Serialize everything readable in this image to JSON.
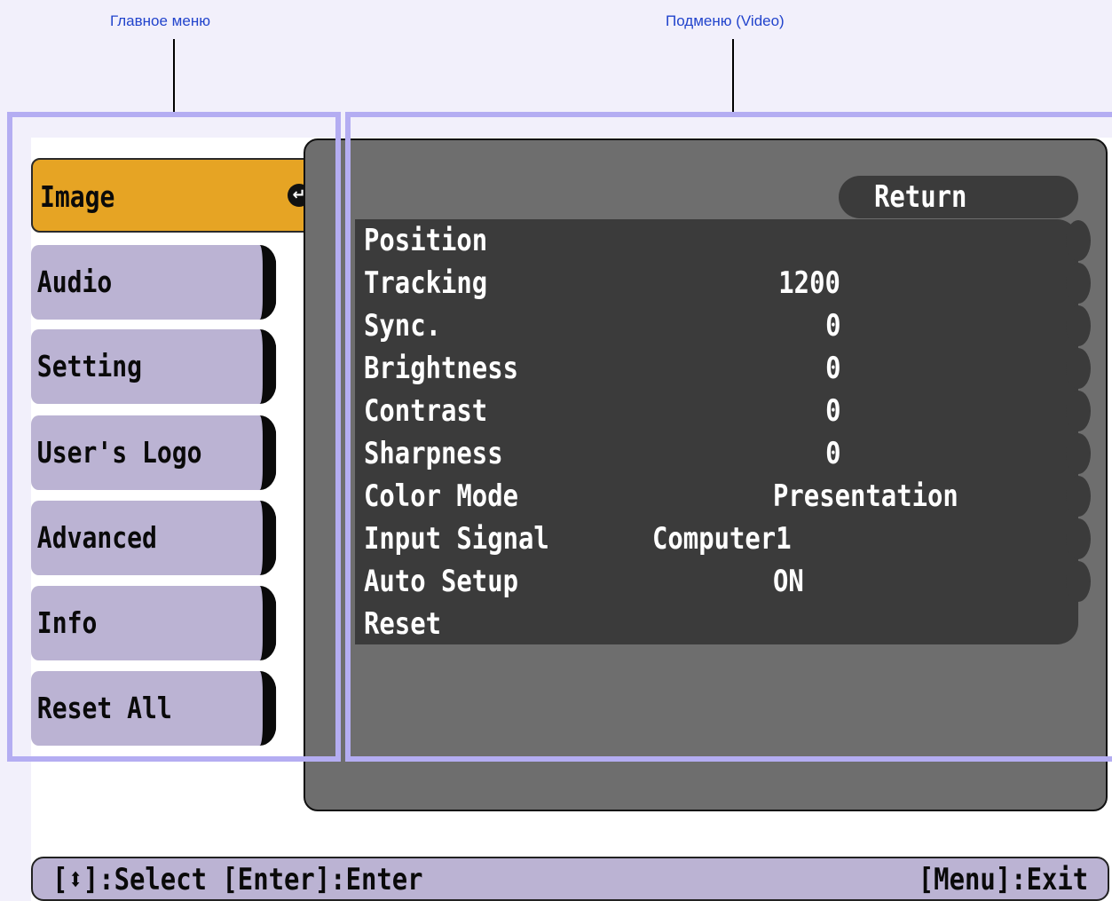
{
  "callouts": {
    "main_menu": "Главное меню",
    "submenu": "Подменю (Video)"
  },
  "main_menu": {
    "items": [
      {
        "label": "Image",
        "active": true
      },
      {
        "label": "Audio"
      },
      {
        "label": "Setting"
      },
      {
        "label": "User's Logo"
      },
      {
        "label": "Advanced"
      },
      {
        "label": "Info"
      },
      {
        "label": "Reset All"
      }
    ],
    "enter_icon": "enter-arrow-icon"
  },
  "submenu": {
    "return_label": "Return",
    "rows": [
      {
        "label": "Position",
        "value": ""
      },
      {
        "label": "Tracking",
        "value": "1200"
      },
      {
        "label": "Sync.",
        "value": "0"
      },
      {
        "label": "Brightness",
        "value": "0"
      },
      {
        "label": "Contrast",
        "value": "0"
      },
      {
        "label": "Sharpness",
        "value": "0"
      },
      {
        "label": "Color Mode",
        "value": "Presentation"
      },
      {
        "label": "Input Signal",
        "value": "Computer1"
      },
      {
        "label": "Auto Setup",
        "value": "ON"
      },
      {
        "label": "Reset",
        "value": ""
      }
    ]
  },
  "status_bar": {
    "left": "[⬍]:Select [Enter]:Enter",
    "right": "[Menu]:Exit"
  },
  "colors": {
    "active_item": "#e6a424",
    "menu_item": "#bbb3d3",
    "panel": "#6e6e6e",
    "list_bg": "#3b3b3b",
    "highlight_box": "#b4adf2",
    "callout_text": "#2244cc"
  }
}
